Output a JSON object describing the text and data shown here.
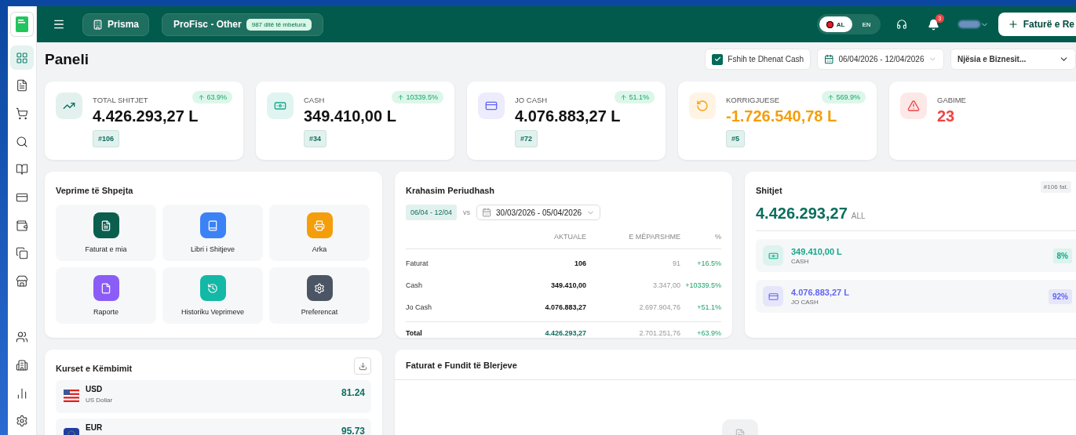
{
  "header": {
    "business": "Prisma",
    "plan": "ProFisc - Other",
    "days_left": "987 ditë të mbetura",
    "languages": [
      {
        "label": "AL",
        "selected": true
      },
      {
        "label": "EN",
        "selected": false
      }
    ],
    "notifications": "3",
    "new_button": "Faturë e Re"
  },
  "sidebar": {
    "items": [
      {
        "selected": true
      },
      {
        "selected": false
      },
      {
        "selected": false
      },
      {
        "selected": false
      },
      {
        "selected": false
      },
      {
        "selected": false
      },
      {
        "selected": false
      },
      {
        "selected": false
      },
      {
        "selected": false
      },
      {
        "selected": false
      },
      {
        "selected": false
      },
      {
        "selected": false
      },
      {
        "selected": false
      }
    ]
  },
  "page_title": "Paneli",
  "filters": {
    "hide_cash": {
      "label": "Fshih te Dhenat Cash",
      "checked": true
    },
    "date_range": "06/04/2026 - 12/04/2026",
    "business_unit": "Njësia e Biznesit..."
  },
  "stats": [
    {
      "kind": "sales",
      "title": "TOTAL SHITJET",
      "value": "4.426.293,27 L",
      "change": "63.9%",
      "count": "#106"
    },
    {
      "kind": "cash",
      "title": "CASH",
      "value": "349.410,00 L",
      "change": "10339.5%",
      "count": "#34"
    },
    {
      "kind": "card",
      "title": "JO CASH",
      "value": "4.076.883,27 L",
      "change": "51.1%",
      "count": "#72"
    },
    {
      "kind": "correction",
      "title": "KORRIGJUESE",
      "value": "-1.726.540,78 L",
      "change": "569.9%",
      "count": "#5"
    },
    {
      "kind": "errors",
      "title": "GABIME",
      "value": "23"
    }
  ],
  "quick_actions": {
    "title": "Veprime të Shpejta",
    "items": [
      {
        "label": "Faturat e mia",
        "color": "#0b5e4e"
      },
      {
        "label": "Libri i Shitjeve",
        "color": "#3b82f6"
      },
      {
        "label": "Arka",
        "color": "#f59e0b"
      },
      {
        "label": "Raporte",
        "color": "#8b5cf6"
      },
      {
        "label": "Historiku Veprimeve",
        "color": "#14b8a6"
      },
      {
        "label": "Preferencat",
        "color": "#4b5563"
      }
    ]
  },
  "comparison": {
    "title": "Krahasim Periudhash",
    "current_period": "06/04 - 12/04",
    "vs": "vs",
    "previous_period": "30/03/2026 - 05/04/2026",
    "columns": [
      "AKTUALE",
      "E MËPARSHME",
      "%"
    ],
    "rows": [
      {
        "label": "Faturat",
        "current": "106",
        "previous": "91",
        "change": "+16.5%"
      },
      {
        "label": "Cash",
        "current": "349.410,00",
        "previous": "3.347,00",
        "change": "+10339.5%"
      },
      {
        "label": "Jo Cash",
        "current": "4.076.883,27",
        "previous": "2.697.904,76",
        "change": "+51.1%"
      }
    ],
    "total": {
      "label": "Total",
      "current": "4.426.293,27",
      "previous": "2.701.251,76",
      "change": "+63.9%"
    }
  },
  "sales": {
    "title": "Shitjet",
    "badge": "#106 fat.",
    "total": "4.426.293,27",
    "currency": "ALL",
    "items": [
      {
        "kind": "cash",
        "value": "349.410,00 L",
        "label": "CASH",
        "share": "8%"
      },
      {
        "kind": "card",
        "value": "4.076.883,27 L",
        "label": "JO CASH",
        "share": "92%"
      }
    ]
  },
  "exchange_rates": {
    "title": "Kurset e Këmbimit",
    "rates": [
      {
        "kind": "usd",
        "code": "USD",
        "name": "US Dollar",
        "rate": "81.24"
      },
      {
        "kind": "eur",
        "code": "EUR",
        "rate": "95.73"
      }
    ]
  },
  "recent_purchases": {
    "title": "Faturat e Fundit të Blerjeve"
  }
}
